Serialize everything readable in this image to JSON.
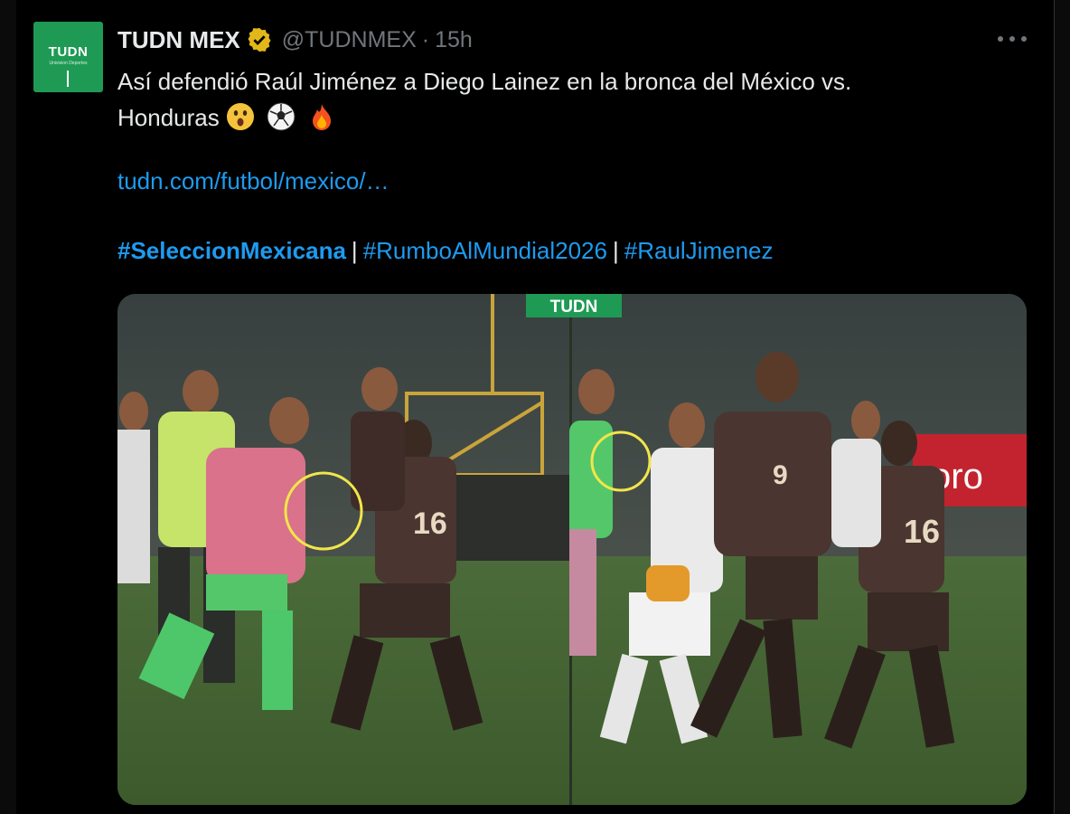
{
  "account": {
    "avatar_text": "TUDN",
    "avatar_subtext": "Univision Deportes",
    "display_name": "TUDN MEX",
    "handle": "@TUDNMEX",
    "separator": "·",
    "time": "15h"
  },
  "tweet": {
    "text_line1": "Así defendió Raúl Jiménez a Diego Lainez en la bronca del México vs.",
    "text_line2": "Honduras",
    "emojis": [
      "astonished-face",
      "soccer-ball",
      "fire"
    ],
    "link": "tudn.com/futbol/mexico/…",
    "hashtags": [
      "#SeleccionMexicana",
      "#RumboAlMundial2026",
      "#RaulJimenez"
    ],
    "hashtag_separator": "|"
  },
  "media": {
    "watermark": "TUDN",
    "banner_text": "oro"
  },
  "colors": {
    "background": "#000000",
    "text": "#e7e9ea",
    "muted": "#71767b",
    "link": "#1d9bf0",
    "verified": "#e2b719",
    "brand_green": "#1f9a55"
  }
}
